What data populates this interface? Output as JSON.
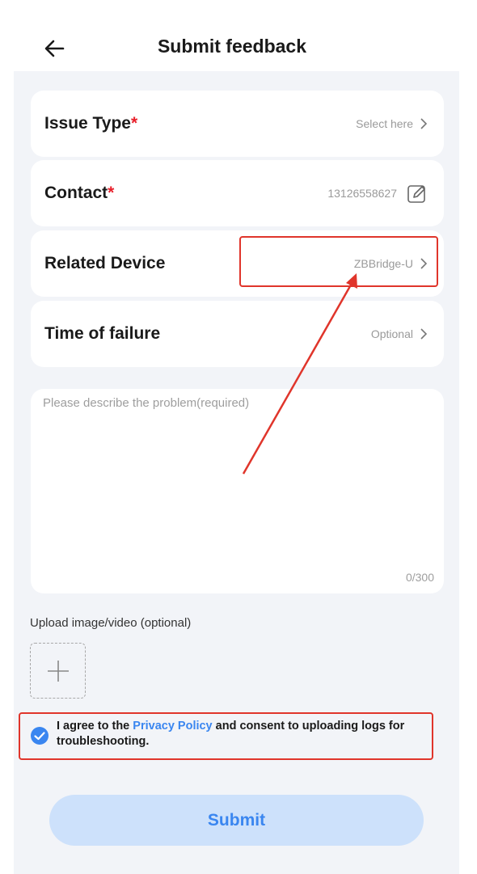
{
  "header": {
    "title": "Submit feedback",
    "back_icon": "arrow-left-icon"
  },
  "form": {
    "rows": [
      {
        "label": "Issue Type",
        "required_mark": "*",
        "value": "Select here"
      },
      {
        "label": "Contact",
        "required_mark": "*",
        "value": "13126558627"
      },
      {
        "label": "Related Device",
        "value": "ZBBridge-U"
      },
      {
        "label": "Time of failure",
        "value": "Optional"
      }
    ],
    "description": {
      "placeholder": "Please describe the problem(required)",
      "counter": "0/300"
    },
    "upload": {
      "label": "Upload image/video (optional)"
    },
    "agreement": {
      "prefix": "I agree to the ",
      "link": "Privacy Policy",
      "suffix": " and consent to uploading logs for troubleshooting.",
      "checked": true
    },
    "submit_label": "Submit"
  },
  "colors": {
    "accent": "#3a86f0",
    "required": "#e8202b",
    "annotation": "#e0352b",
    "panel_bg": "#f2f4f8"
  }
}
